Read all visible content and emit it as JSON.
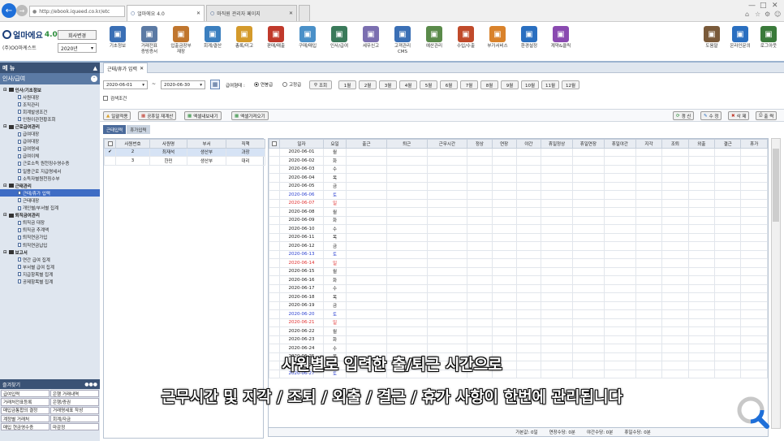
{
  "browser": {
    "url": "http://ebook.iqueed.co.kr/etc",
    "tabs": [
      "얼마에요 4.0",
      "마직원 관리자 페이지"
    ],
    "colors": {
      "back": "#1e6fd9"
    }
  },
  "toolbar": {
    "app_name": "얼마에요",
    "version": "4.0",
    "company": "(주)OO마케스트",
    "tax_button": "회사변경",
    "year": "2020년",
    "buttons": [
      {
        "label": "기초정보",
        "icon": "book-icon",
        "color": "#3a6fb5"
      },
      {
        "label": "거래전표\n증빙증서",
        "icon": "document-icon",
        "color": "#5b7aa4"
      },
      {
        "label": "입출금장부\n재장",
        "icon": "house-icon",
        "color": "#c0762e"
      },
      {
        "label": "회계/결산",
        "icon": "ledger-icon",
        "color": "#3b7fbf"
      },
      {
        "label": "총록/미고",
        "icon": "pencil-icon",
        "color": "#d49a2b"
      },
      {
        "label": "판매/매출",
        "icon": "cart-icon",
        "color": "#c0392b"
      },
      {
        "label": "구매/매입",
        "icon": "box-icon",
        "color": "#4a90c8"
      },
      {
        "label": "인사/급여",
        "icon": "people-icon",
        "color": "#3a7a5a"
      },
      {
        "label": "세무신고",
        "icon": "tax-icon",
        "color": "#7b6fb0"
      },
      {
        "label": "고객관리\nCMS",
        "icon": "user-icon",
        "color": "#3a6fb5"
      },
      {
        "label": "예산관리",
        "icon": "chart-icon",
        "color": "#5a8a4a"
      },
      {
        "label": "수입/수출",
        "icon": "ship-icon",
        "color": "#c04a2a"
      },
      {
        "label": "부가서비스",
        "icon": "gift-icon",
        "color": "#d9822b"
      },
      {
        "label": "환경설정",
        "icon": "gear-icon",
        "color": "#2a6fc0"
      },
      {
        "label": "계약&클릭",
        "icon": "spark-icon",
        "color": "#8a4ab0"
      }
    ],
    "right_buttons": [
      {
        "label": "도움말",
        "icon": "help-icon",
        "color": "#7a5a3a"
      },
      {
        "label": "온라인문의",
        "icon": "chat-icon",
        "color": "#2a6fc0"
      },
      {
        "label": "로그아웃",
        "icon": "logout-icon",
        "color": "#3a7a3a"
      }
    ]
  },
  "sidebar": {
    "title": "메 뉴",
    "section": "인사/급여",
    "tree": [
      {
        "t": "f",
        "label": "인사/기초정보"
      },
      {
        "t": "i",
        "label": "사원대장"
      },
      {
        "t": "i",
        "label": "조직관리"
      },
      {
        "t": "i",
        "label": "회계발생조건"
      },
      {
        "t": "i",
        "label": "인원이관현황조회"
      },
      {
        "t": "f",
        "label": "근로급여관리"
      },
      {
        "t": "i",
        "label": "급여대장"
      },
      {
        "t": "i",
        "label": "급여대장"
      },
      {
        "t": "i",
        "label": "급여명세"
      },
      {
        "t": "i",
        "label": "급여이체"
      },
      {
        "t": "i",
        "label": "근로소득 원천징수영수증"
      },
      {
        "t": "i",
        "label": "일용근로 지급명세서"
      },
      {
        "t": "i",
        "label": "소득자별원천징수부"
      },
      {
        "t": "f",
        "label": "근태관리"
      },
      {
        "t": "i",
        "label": "근태/휴가 입력",
        "sel": true
      },
      {
        "t": "i",
        "label": "근태대장"
      },
      {
        "t": "i",
        "label": "개인별/부서별 집계"
      },
      {
        "t": "f",
        "label": "퇴직금여관리"
      },
      {
        "t": "i",
        "label": "퇴직금 대장"
      },
      {
        "t": "i",
        "label": "퇴직금 추계액"
      },
      {
        "t": "i",
        "label": "퇴직연금가입"
      },
      {
        "t": "i",
        "label": "퇴직연금납입"
      },
      {
        "t": "f",
        "label": "보고서"
      },
      {
        "t": "i",
        "label": "연간 급여 집계"
      },
      {
        "t": "i",
        "label": "부서별 급여 집계"
      },
      {
        "t": "i",
        "label": "지급항목별 집계"
      },
      {
        "t": "i",
        "label": "공제항목별 집계"
      }
    ],
    "favorites_title": "즐겨찾기",
    "favorites": [
      [
        "급여입력",
        "은행 거래내역"
      ],
      [
        "거래처전표등록",
        "은행/증권"
      ],
      [
        "매입금통합의 결정",
        "거래명세표 작성"
      ],
      [
        "계정별 거래처",
        "회계/자금"
      ],
      [
        "매입 현금영수증",
        "마감정"
      ]
    ]
  },
  "main": {
    "page_tab": "근태/휴가 입력",
    "date_from": "2020-06-01",
    "date_sep": "~",
    "date_to": "2020-06-30",
    "pay_label": "급여형태 :",
    "radio_1": "연봉급",
    "radio_2": "고정급",
    "search": "조회",
    "months": [
      "1월",
      "2월",
      "3월",
      "4월",
      "5월",
      "6월",
      "7월",
      "8월",
      "9월",
      "10월",
      "11월",
      "12월"
    ],
    "condition": "검색조건",
    "left_actions": [
      "일괄적용",
      "공휴일 재계산",
      "엑셀내보내기",
      "엑셀가져오기"
    ],
    "right_actions": [
      "갱 신",
      "수 정",
      "삭 제",
      "출 력"
    ],
    "subtabs": [
      "근태입력",
      "휴가입력"
    ],
    "emp_headers": [
      "사원번호",
      "사원명",
      "부서",
      "직책"
    ],
    "employees": [
      [
        "2",
        "최재석",
        "생산부",
        "과장"
      ],
      [
        "3",
        "한민",
        "생산부",
        "대리"
      ]
    ],
    "att_headers": [
      "일자",
      "요일",
      "출근",
      "퇴근",
      "근무시간",
      "정상",
      "연장",
      "야간",
      "휴일정상",
      "휴일연장",
      "휴일야간",
      "지각",
      "조퇴",
      "외출",
      "결근",
      "휴가"
    ],
    "days": [
      [
        "2020-06-01",
        "월"
      ],
      [
        "2020-06-02",
        "화"
      ],
      [
        "2020-06-03",
        "수"
      ],
      [
        "2020-06-04",
        "목"
      ],
      [
        "2020-06-05",
        "금"
      ],
      [
        "2020-06-06",
        "토"
      ],
      [
        "2020-06-07",
        "일"
      ],
      [
        "2020-06-08",
        "월"
      ],
      [
        "2020-06-09",
        "화"
      ],
      [
        "2020-06-10",
        "수"
      ],
      [
        "2020-06-11",
        "목"
      ],
      [
        "2020-06-12",
        "금"
      ],
      [
        "2020-06-13",
        "토"
      ],
      [
        "2020-06-14",
        "일"
      ],
      [
        "2020-06-15",
        "월"
      ],
      [
        "2020-06-16",
        "화"
      ],
      [
        "2020-06-17",
        "수"
      ],
      [
        "2020-06-18",
        "목"
      ],
      [
        "2020-06-19",
        "금"
      ],
      [
        "2020-06-20",
        "토"
      ],
      [
        "2020-06-21",
        "일"
      ],
      [
        "2020-06-22",
        "월"
      ],
      [
        "2020-06-23",
        "화"
      ],
      [
        "2020-06-24",
        "수"
      ],
      [
        "2020-06-25",
        "목"
      ],
      [
        "2020-06-26",
        "금"
      ],
      [
        "2020-06-27",
        "토"
      ]
    ],
    "summary": [
      "가본값: 0일",
      "연장수당: 0분",
      "야간수당: 0분",
      "휴일수당: 0분"
    ]
  },
  "captions": {
    "line1": "사원별로 입력한 출/퇴근 시간으로",
    "line2": "근무시간 및 지각 / 조퇴 / 외출 / 결근 / 휴가 사항이 한번에 관리됩니다"
  }
}
